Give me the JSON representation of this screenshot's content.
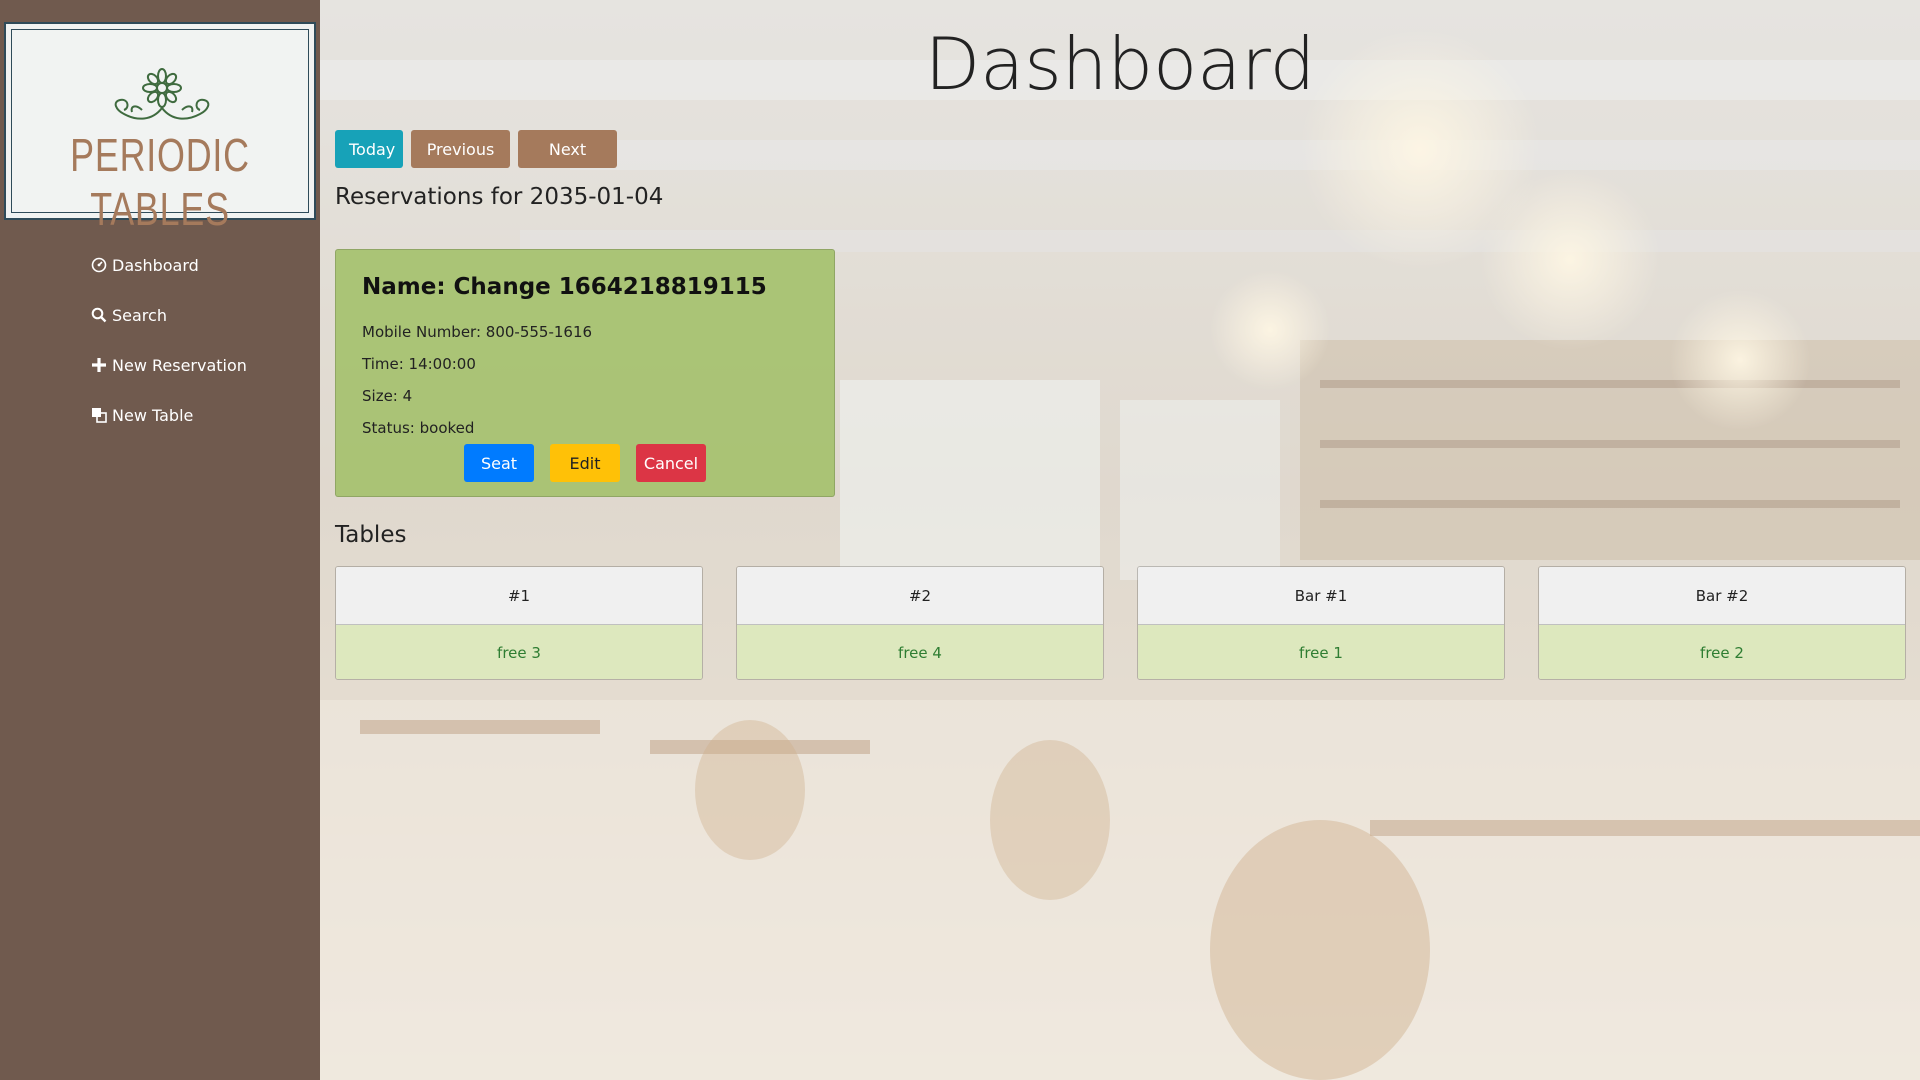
{
  "brand": {
    "logo_text": "PERIODIC TABLES"
  },
  "sidebar": {
    "items": [
      {
        "label": "Dashboard",
        "icon": "dashboard-icon"
      },
      {
        "label": "Search",
        "icon": "search-icon"
      },
      {
        "label": "New Reservation",
        "icon": "plus-icon"
      },
      {
        "label": "New Table",
        "icon": "table-icon"
      }
    ]
  },
  "main": {
    "title": "Dashboard",
    "date_buttons": {
      "today": "Today",
      "previous": "Previous",
      "next": "Next"
    },
    "reservations_heading": "Reservations for 2035-01-04",
    "reservation": {
      "name": "Name: Change 1664218819115",
      "mobile": "Mobile Number: 800-555-1616",
      "time": "Time: 14:00:00",
      "size": "Size: 4",
      "status": "Status: booked",
      "seat_label": "Seat",
      "edit_label": "Edit",
      "cancel_label": "Cancel"
    },
    "tables_heading": "Tables",
    "tables": [
      {
        "name": "#1",
        "status": "free 3"
      },
      {
        "name": "#2",
        "status": "free 4"
      },
      {
        "name": "Bar #1",
        "status": "free 1"
      },
      {
        "name": "Bar #2",
        "status": "free 2"
      }
    ]
  },
  "colors": {
    "sidebar_bg": "#705a4e",
    "brand_brown": "#a57a5c",
    "today_button": "#17a2b8",
    "card_green": "#a5c16e",
    "seat": "#007bff",
    "edit": "#ffc107",
    "cancel": "#dc3545"
  }
}
